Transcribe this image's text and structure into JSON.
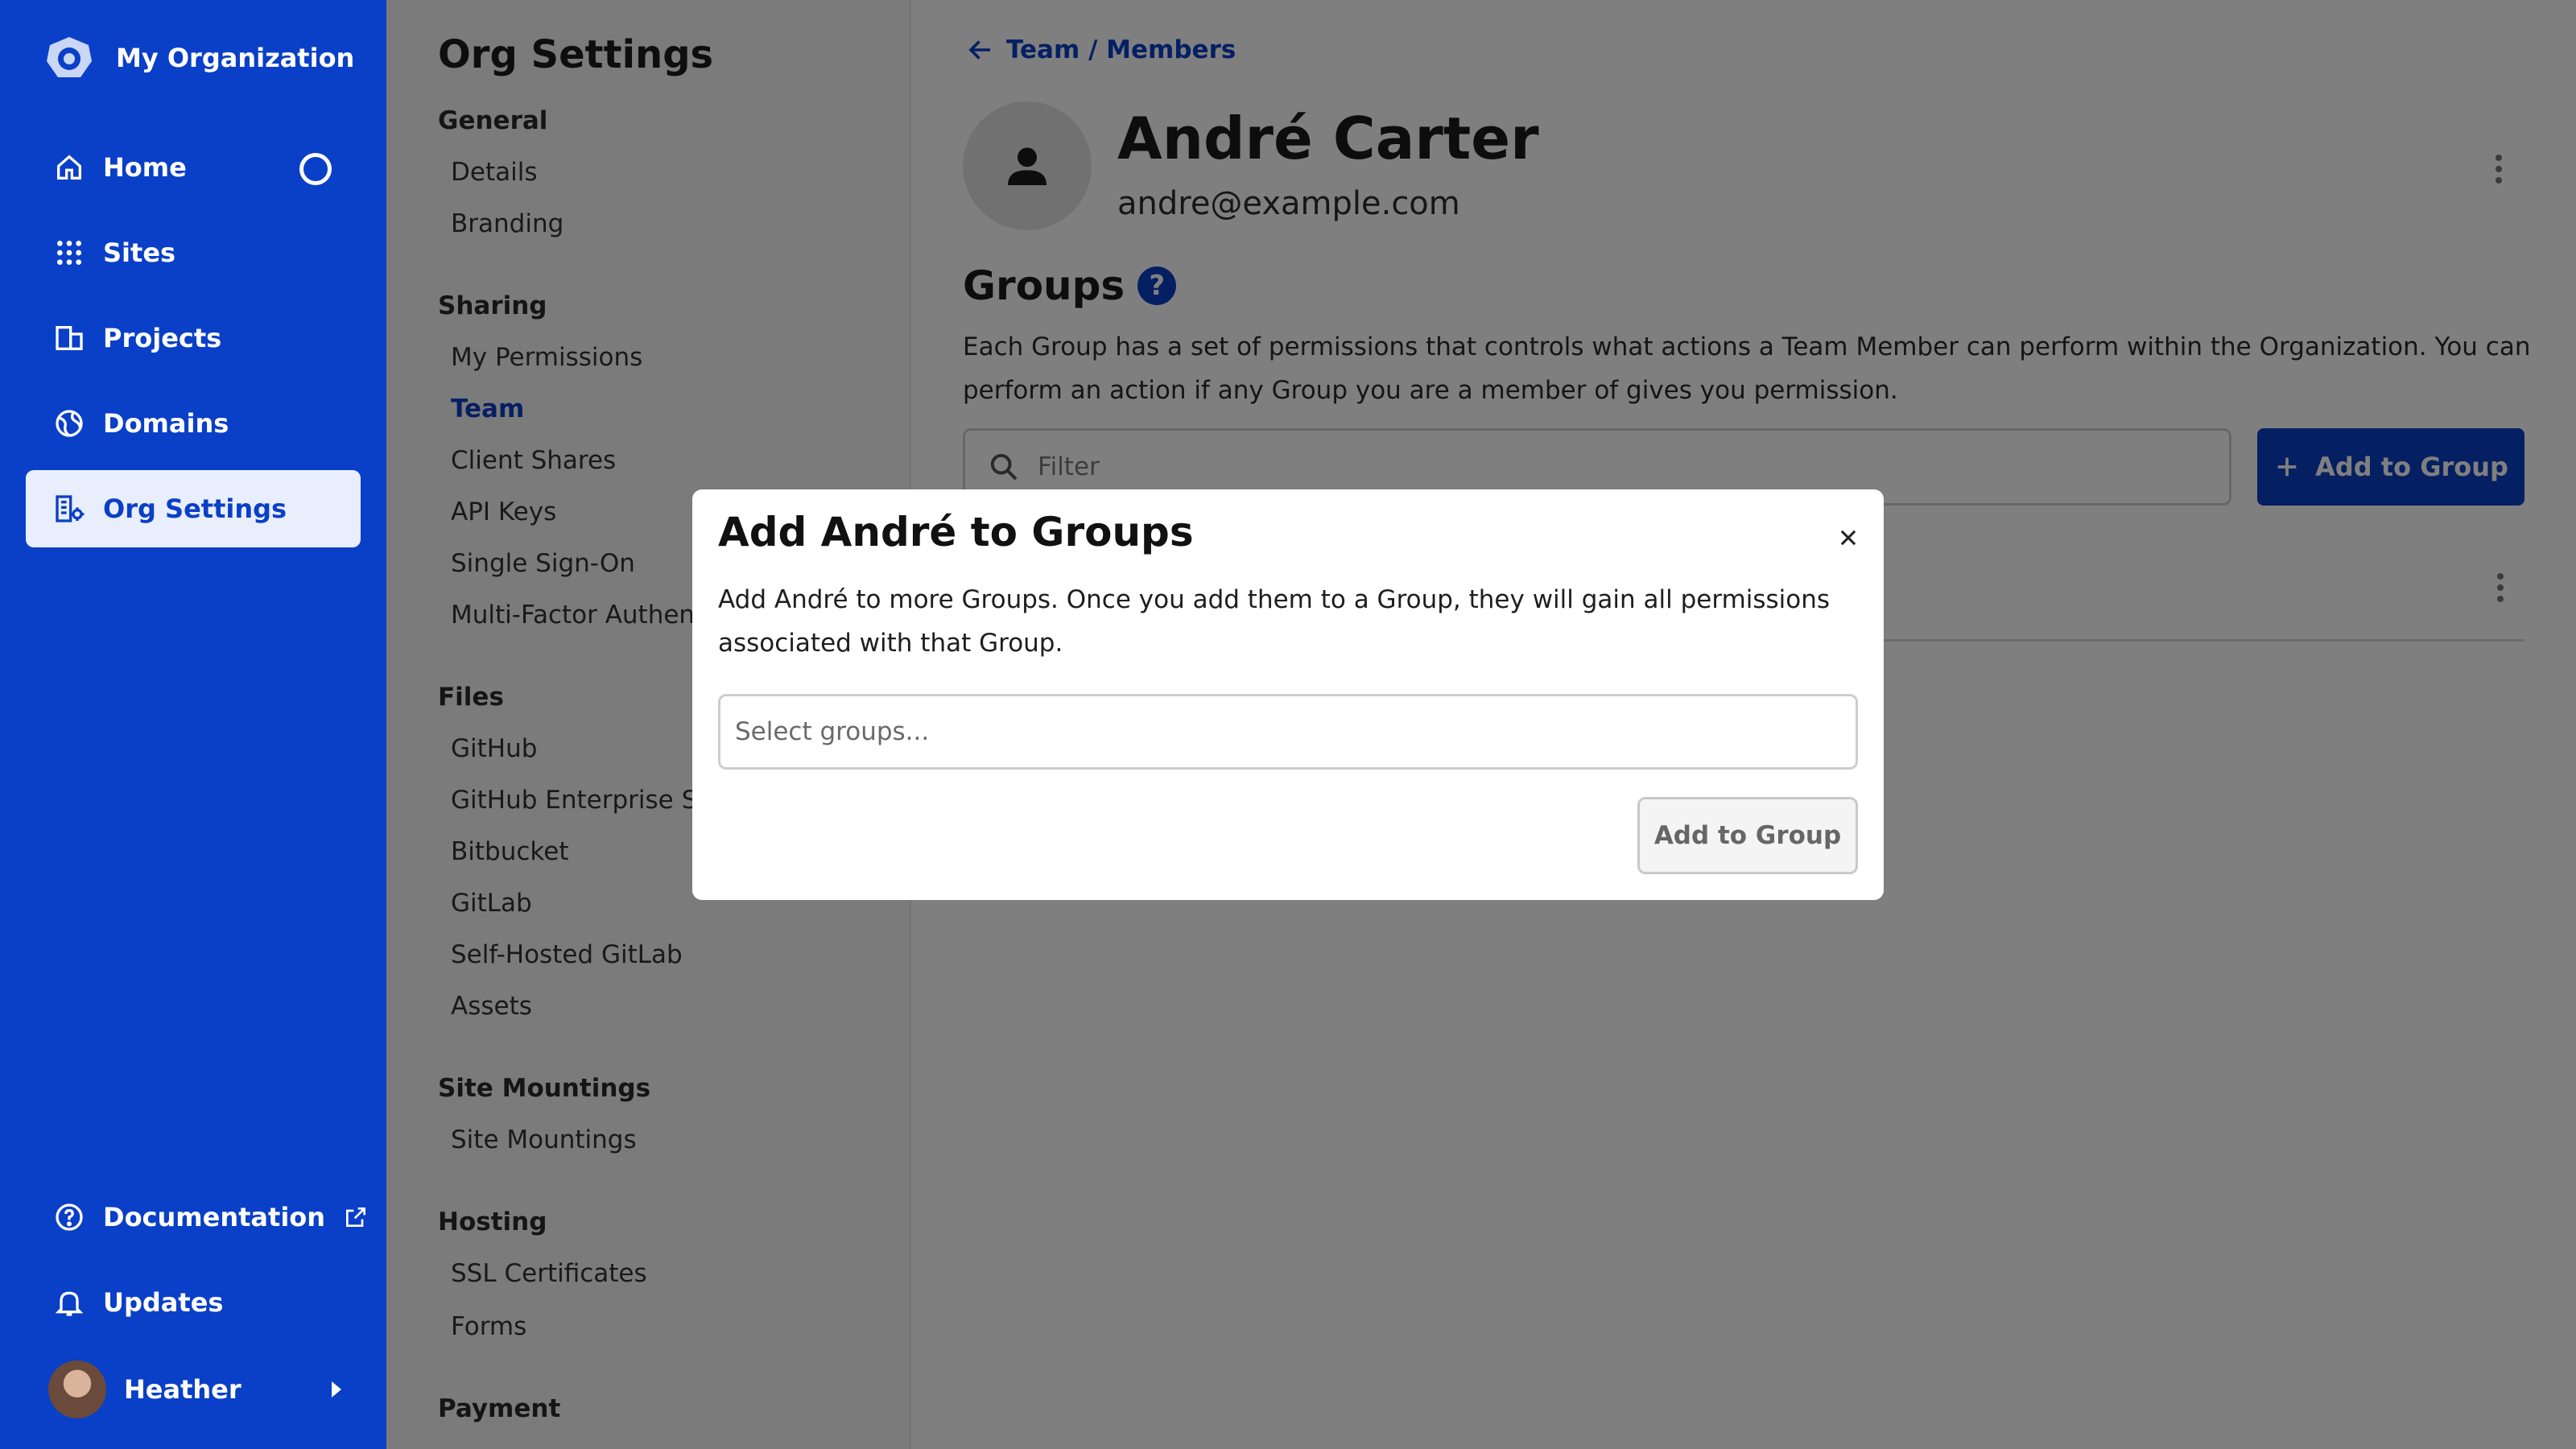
{
  "colors": {
    "brand": "#0a3fc7",
    "sidebar_bg": "#0a3fc7",
    "settings_bg": "#f7f7f7",
    "overlay": "rgba(0,0,0,0.5)"
  },
  "sidebar": {
    "org_name": "My Organization",
    "items": [
      {
        "label": "Home",
        "icon": "home-icon"
      },
      {
        "label": "Sites",
        "icon": "grid-icon"
      },
      {
        "label": "Projects",
        "icon": "projects-icon"
      },
      {
        "label": "Domains",
        "icon": "globe-icon"
      },
      {
        "label": "Org Settings",
        "icon": "org-settings-icon",
        "active": true
      }
    ],
    "bottom_items": [
      {
        "label": "Documentation",
        "icon": "help-circle-icon"
      },
      {
        "label": "Updates",
        "icon": "bell-icon"
      }
    ],
    "user_name": "Heather"
  },
  "settings": {
    "title": "Org Settings",
    "sections": [
      {
        "heading": "General",
        "items": [
          "Details",
          "Branding"
        ]
      },
      {
        "heading": "Sharing",
        "items": [
          "My Permissions",
          "Team",
          "Client Shares",
          "API Keys",
          "Single Sign-On",
          "Multi-Factor Authent"
        ]
      },
      {
        "heading": "Files",
        "items": [
          "GitHub",
          "GitHub Enterprise Se",
          "Bitbucket",
          "GitLab",
          "Self-Hosted GitLab",
          "Assets"
        ]
      },
      {
        "heading": "Site Mountings",
        "items": [
          "Site Mountings"
        ]
      },
      {
        "heading": "Hosting",
        "items": [
          "SSL Certificates",
          "Forms"
        ]
      },
      {
        "heading": "Payment",
        "items": []
      }
    ],
    "active_item": "Team"
  },
  "main": {
    "breadcrumb": "Team / Members",
    "user_name": "André Carter",
    "user_email": "andre@example.com",
    "groups_title": "Groups",
    "help_label": "?",
    "groups_description": "Each Group has a set of permissions that controls what actions a Team Member can perform within the Organization. You can perform an action if any Group you are a member of gives you permission.",
    "filter_placeholder": "Filter",
    "add_button_label": "Add to Group"
  },
  "modal": {
    "title": "Add André to Groups",
    "description": "Add André to more Groups. Once you add them to a Group, they will gain all permissions associated with that Group.",
    "select_placeholder": "Select groups...",
    "submit_label": "Add to Group"
  }
}
